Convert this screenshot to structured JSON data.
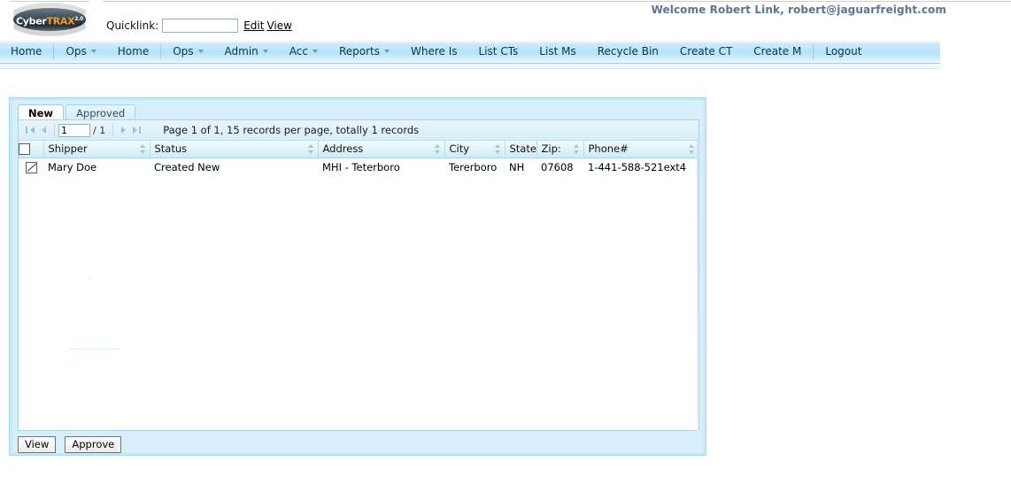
{
  "header": {
    "logo": {
      "cyber": "Cyber",
      "trax": "TRAX",
      "version": "2.0"
    },
    "quicklink": {
      "label": "Quicklink:",
      "value": "",
      "placeholder": "",
      "edit_label": "Edit",
      "view_label": "View"
    },
    "welcome": "Welcome Robert Link, robert@jaguarfreight.com",
    "welcome_color": "#5b7596"
  },
  "nav": {
    "items": [
      {
        "label": "Home",
        "has_caret": false,
        "sep_after": true
      },
      {
        "label": "Ops",
        "has_caret": true,
        "sep_after": false
      },
      {
        "label": "Home",
        "has_caret": false,
        "sep_after": true
      },
      {
        "label": "Ops",
        "has_caret": true,
        "sep_after": false
      },
      {
        "label": "Admin",
        "has_caret": true,
        "sep_after": false
      },
      {
        "label": "Acc",
        "has_caret": true,
        "sep_after": false
      },
      {
        "label": "Reports",
        "has_caret": true,
        "sep_after": false
      },
      {
        "label": "Where Is",
        "has_caret": false,
        "sep_after": false
      },
      {
        "label": "List CTs",
        "has_caret": false,
        "sep_after": false
      },
      {
        "label": "List Ms",
        "has_caret": false,
        "sep_after": false
      },
      {
        "label": "Recycle Bin",
        "has_caret": false,
        "sep_after": false
      },
      {
        "label": "Create CT",
        "has_caret": false,
        "sep_after": false
      },
      {
        "label": "Create M",
        "has_caret": false,
        "sep_after": true
      },
      {
        "label": "Logout",
        "has_caret": false,
        "sep_after": false
      }
    ]
  },
  "panel": {
    "tabs": [
      {
        "label": "New",
        "active": true
      },
      {
        "label": "Approved",
        "active": false
      }
    ],
    "pager": {
      "page_value": "1",
      "total_pages": "/ 1",
      "status": "Page 1 of 1, 15 records per page, totally 1 records",
      "first_title": "First",
      "prev_title": "Previous",
      "next_title": "Next",
      "last_title": "Last"
    },
    "table": {
      "select_all_checked": false,
      "columns": [
        {
          "label": "Shipper",
          "sortable": true
        },
        {
          "label": "Status",
          "sortable": true
        },
        {
          "label": "Address",
          "sortable": true
        },
        {
          "label": "City",
          "sortable": true
        },
        {
          "label": "State",
          "sortable": true
        },
        {
          "label": "Zip:",
          "sortable": true
        },
        {
          "label": "Phone#",
          "sortable": true
        }
      ],
      "rows": [
        {
          "checked": true,
          "shipper": "Mary Doe",
          "status": "Created New",
          "address": "MHI - Teterboro",
          "city": "Tererboro",
          "state": "NH",
          "zip": "07608",
          "phone": "1-441-588-521ext4"
        }
      ]
    },
    "footer": {
      "view_label": "View",
      "approve_label": "Approve"
    }
  }
}
